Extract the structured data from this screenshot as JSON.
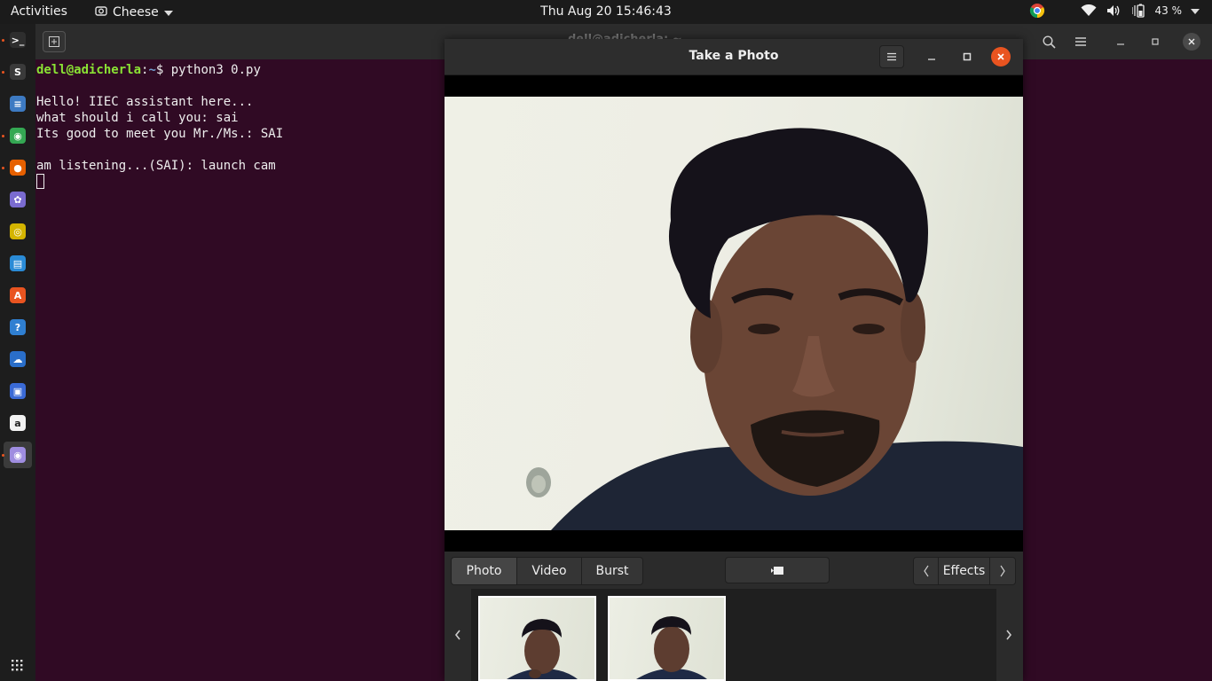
{
  "topbar": {
    "activities": "Activities",
    "app_name": "Cheese",
    "clock": "Thu Aug 20  15:46:43",
    "battery": "43 %"
  },
  "dock": {
    "items": [
      {
        "name": "terminal",
        "icon": "terminal-icon",
        "color": "#2e2e2e",
        "glyph": ">_"
      },
      {
        "name": "sublime-text",
        "icon": "sublime-icon",
        "color": "#3a3a3a",
        "glyph": "S"
      },
      {
        "name": "files",
        "icon": "files-icon",
        "color": "#3d7ac2",
        "glyph": "≡"
      },
      {
        "name": "chrome",
        "icon": "chrome-icon",
        "color": "#34a853",
        "glyph": "◉"
      },
      {
        "name": "firefox",
        "icon": "firefox-icon",
        "color": "#e66000",
        "glyph": "●"
      },
      {
        "name": "shotwell",
        "icon": "shotwell-icon",
        "color": "#7a6bd0",
        "glyph": "✿"
      },
      {
        "name": "rhythmbox",
        "icon": "rhythmbox-icon",
        "color": "#d4b400",
        "glyph": "◎"
      },
      {
        "name": "writer",
        "icon": "writer-icon",
        "color": "#2a8bd6",
        "glyph": "▤"
      },
      {
        "name": "software",
        "icon": "software-icon",
        "color": "#e95420",
        "glyph": "A"
      },
      {
        "name": "help",
        "icon": "help-icon",
        "color": "#2f7fd1",
        "glyph": "?"
      },
      {
        "name": "teams",
        "icon": "teams-icon",
        "color": "#2a6ec9",
        "glyph": "☁"
      },
      {
        "name": "screenshot",
        "icon": "screenshot-icon",
        "color": "#3a6ad6",
        "glyph": "▣"
      },
      {
        "name": "amazon",
        "icon": "amazon-icon",
        "color": "#f2f2f2",
        "glyph": "a"
      },
      {
        "name": "cheese",
        "icon": "cheese-icon",
        "color": "#9f8de0",
        "glyph": "◉"
      }
    ],
    "apps_grid": "show-apps-icon"
  },
  "terminal": {
    "title": "dell@adicherla: ~",
    "prompt_user": "dell@adicherla",
    "prompt_path": "~",
    "command": "$ python3 0.py",
    "lines": [
      "Hello! IIEC assistant here...",
      "what should i call you: sai",
      "Its good to meet you Mr./Ms.: SAI",
      "am listening...(SAI): launch cam"
    ]
  },
  "cheese": {
    "title": "Take a Photo",
    "modes": [
      "Photo",
      "Video",
      "Burst"
    ],
    "active_mode": "Photo",
    "effects": "Effects"
  }
}
